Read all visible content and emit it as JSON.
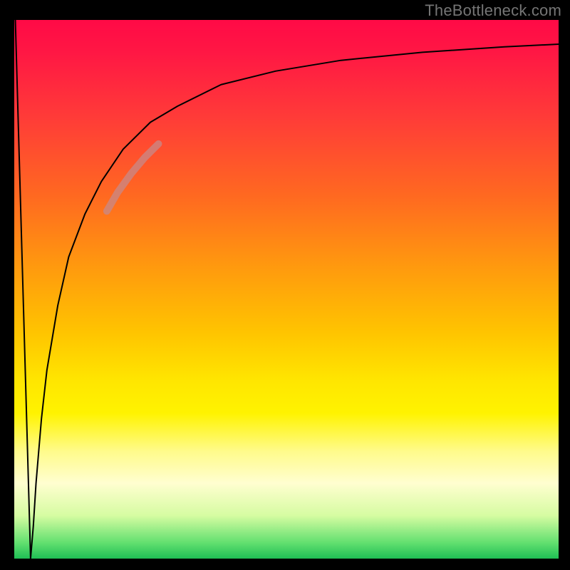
{
  "watermark": "TheBottleneck.com",
  "chart_data": {
    "type": "line",
    "title": "",
    "xlabel": "",
    "ylabel": "",
    "xlim": [
      0,
      100
    ],
    "ylim": [
      0,
      100
    ],
    "grid": false,
    "legend": false,
    "series": [
      {
        "name": "left-spike",
        "x": [
          0.2,
          3.0
        ],
        "y": [
          100,
          0
        ],
        "color": "#000",
        "width": 2
      },
      {
        "name": "main-curve",
        "x": [
          3.0,
          3.5,
          4.0,
          5.0,
          6.0,
          8.0,
          10.0,
          13.0,
          16.0,
          20.0,
          25.0,
          30.0,
          38.0,
          48.0,
          60.0,
          75.0,
          90.0,
          100.0
        ],
        "y": [
          0,
          6,
          14,
          26,
          35,
          47,
          56,
          64,
          70,
          76,
          81,
          84,
          88,
          90.5,
          92.5,
          94,
          95,
          95.5
        ],
        "color": "#000",
        "width": 2
      },
      {
        "name": "highlight-segment",
        "x": [
          17.0,
          19.0,
          21.5,
          24.0,
          26.5
        ],
        "y": [
          64.5,
          68.0,
          71.5,
          74.5,
          77.0
        ],
        "color": "#c78a8a",
        "width": 10
      }
    ],
    "gradient_stops": [
      {
        "pct": 0,
        "color": "#ff0a46"
      },
      {
        "pct": 6,
        "color": "#ff1744"
      },
      {
        "pct": 18,
        "color": "#ff3b38"
      },
      {
        "pct": 33,
        "color": "#ff6a20"
      },
      {
        "pct": 46,
        "color": "#ff9a0e"
      },
      {
        "pct": 58,
        "color": "#ffc400"
      },
      {
        "pct": 67,
        "color": "#ffe600"
      },
      {
        "pct": 73,
        "color": "#fff300"
      },
      {
        "pct": 80,
        "color": "#fffb8a"
      },
      {
        "pct": 86,
        "color": "#fffed0"
      },
      {
        "pct": 92,
        "color": "#d6fca2"
      },
      {
        "pct": 97,
        "color": "#63e070"
      },
      {
        "pct": 100,
        "color": "#1fbf55"
      }
    ]
  }
}
